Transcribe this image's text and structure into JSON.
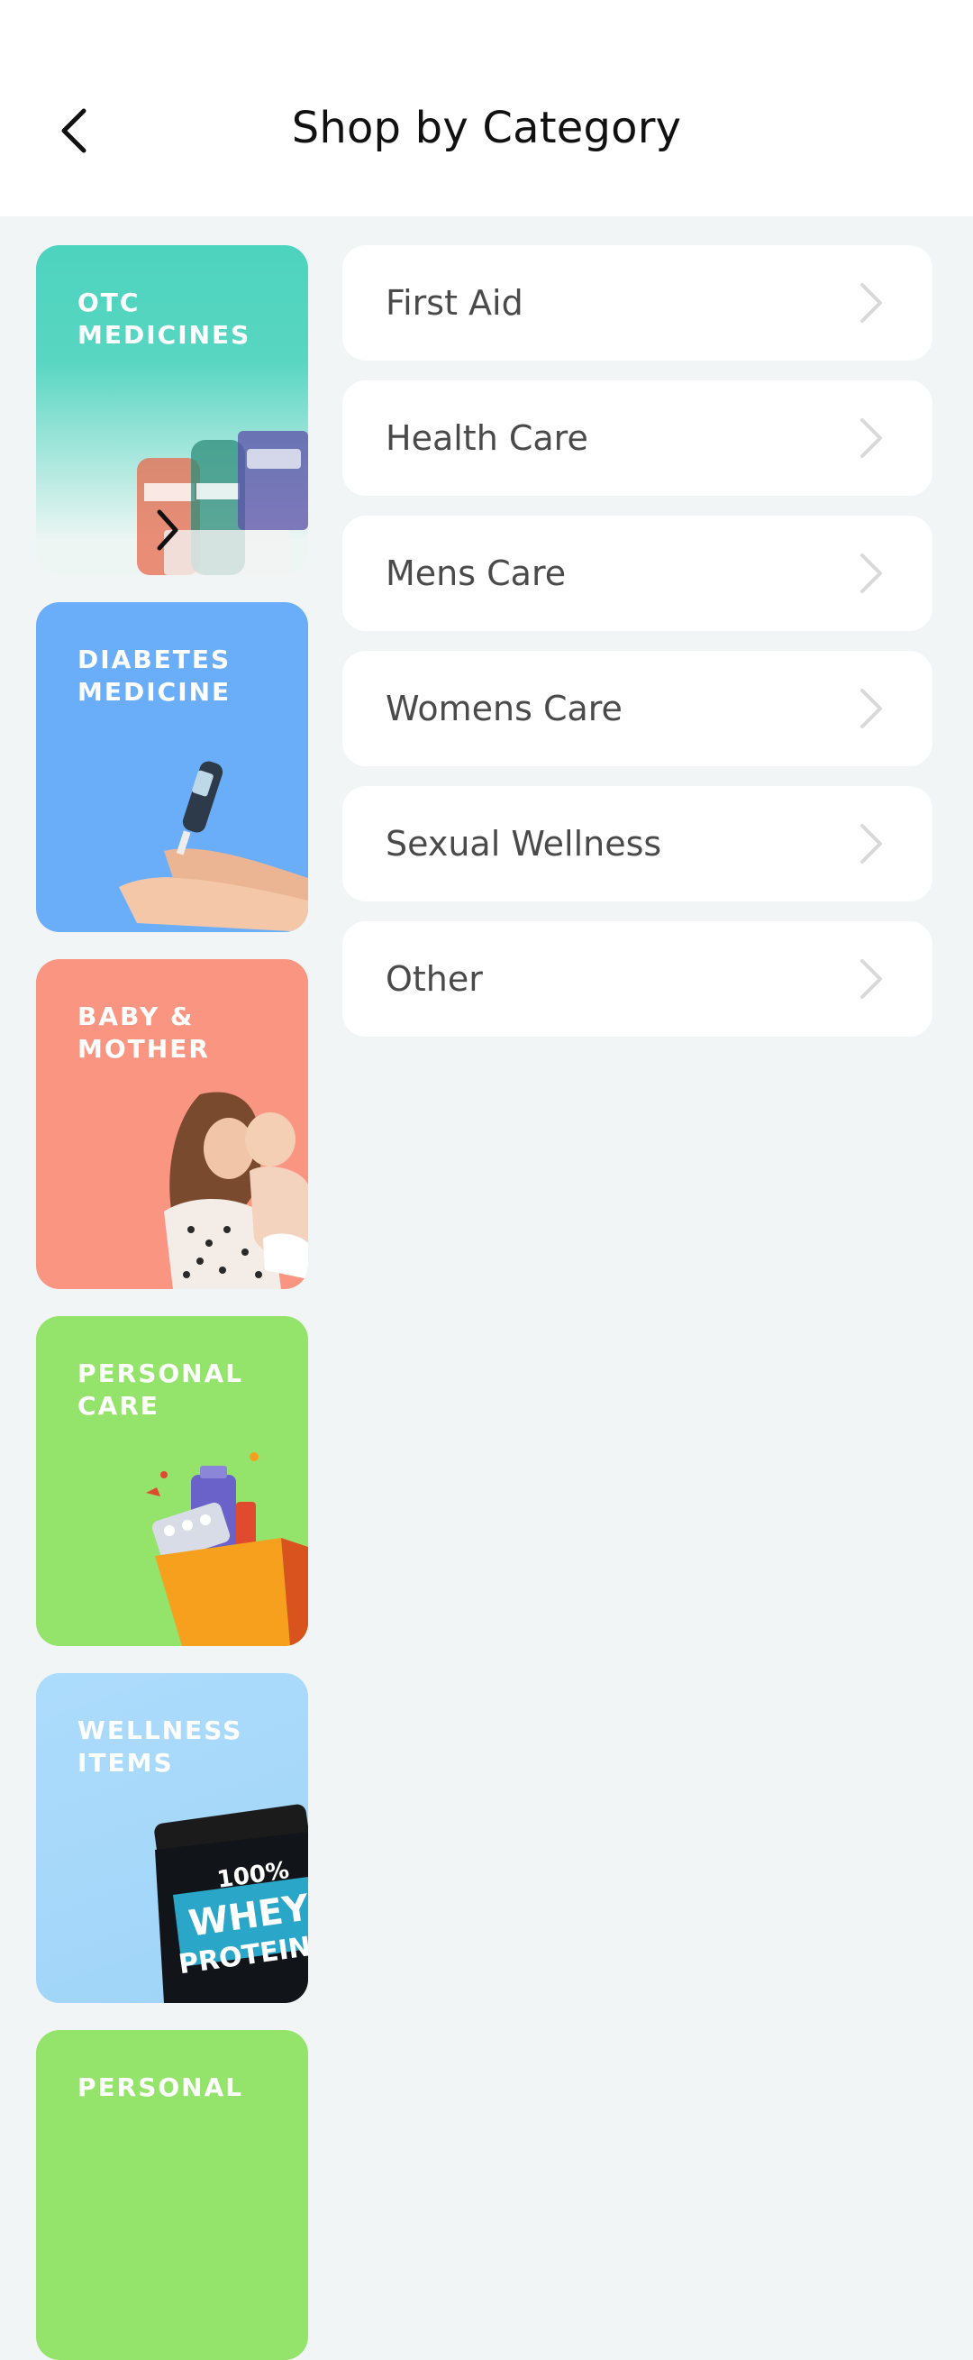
{
  "header": {
    "title": "Shop by Category",
    "back_icon": "chevron-left-icon"
  },
  "categories": [
    {
      "label": "OTC\nMEDICINES",
      "color_top": "#4DD4BE",
      "color_bottom": "#EEF6F4",
      "selected": true,
      "selected_icon": "chevron-right-icon"
    },
    {
      "label": "DIABETES\nMEDICINE",
      "color": "#6AAEF9"
    },
    {
      "label": "BABY &\nMOTHER",
      "color": "#FA9582"
    },
    {
      "label": "PERSONAL\nCARE",
      "color": "#94E36A"
    },
    {
      "label": "WELLNESS\nITEMS",
      "color": "#ADDCFC",
      "art_text": [
        "100%",
        "WHEY",
        "PROTEIN"
      ]
    },
    {
      "label": "PERSONAL",
      "color": "#94E36A"
    }
  ],
  "subcategories": [
    {
      "label": "First Aid"
    },
    {
      "label": "Health Care"
    },
    {
      "label": "Mens Care"
    },
    {
      "label": "Womens Care"
    },
    {
      "label": "Sexual Wellness"
    },
    {
      "label": "Other"
    }
  ],
  "colors": {
    "background": "#F2F5F6",
    "card": "#FFFFFF",
    "text_primary": "#111111",
    "text_secondary": "#4A4A4A",
    "chevron": "#D9D9D9"
  }
}
